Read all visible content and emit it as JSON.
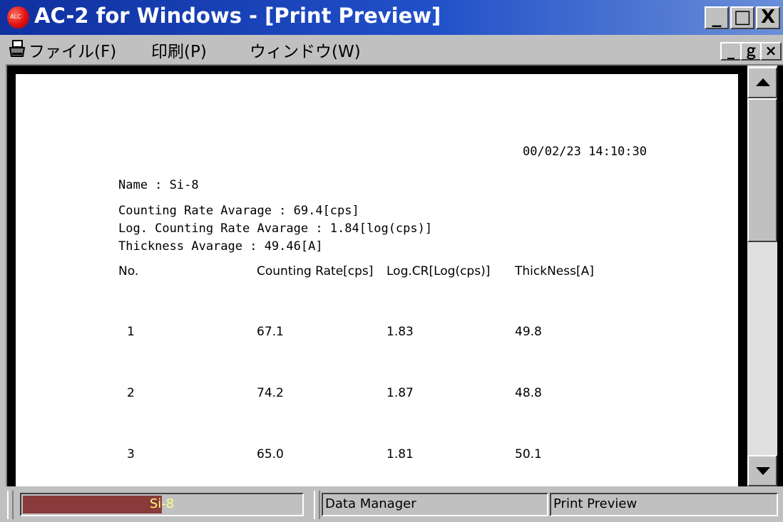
{
  "window": {
    "title": "AC-2 for Windows - [Print Preview]",
    "icon_text": "ALC",
    "minimize_glyph": "_",
    "maximize_glyph": "□",
    "close_glyph": "X"
  },
  "menu": {
    "items": [
      {
        "label": "ファイル(F)"
      },
      {
        "label": "印刷(P)"
      },
      {
        "label": "ウィンドウ(W)"
      }
    ],
    "mdi_minimize_glyph": "_",
    "mdi_restore_glyph": "ｇ",
    "mdi_close_glyph": "×"
  },
  "report": {
    "timestamp": "00/02/23 14:10:30",
    "name_line": "Name : Si-8",
    "counting_rate_avg": "Counting Rate Avarage : 69.4[cps]",
    "log_counting_rate_avg": "Log. Counting Rate Avarage : 1.84[log(cps)]",
    "thickness_avg": "Thickness Avarage : 49.46[A]",
    "columns": [
      "No.",
      "Counting Rate[cps]",
      "Log.CR[Log(cps)]",
      "ThickNess[A]"
    ],
    "rows": [
      [
        "1",
        "67.1",
        "1.83",
        "49.8"
      ],
      [
        "2",
        "74.2",
        "1.87",
        "48.8"
      ],
      [
        "3",
        "65.0",
        "1.81",
        "50.1"
      ]
    ]
  },
  "status": {
    "progress_label": "Si-8",
    "progress_fraction": 0.5,
    "progress_color": "#8a3a3a",
    "panel2": "Data Manager",
    "panel3": "Print Preview"
  },
  "icons": [
    "app-logo-icon",
    "printer-icon",
    "scroll-up-icon",
    "scroll-down-icon"
  ]
}
